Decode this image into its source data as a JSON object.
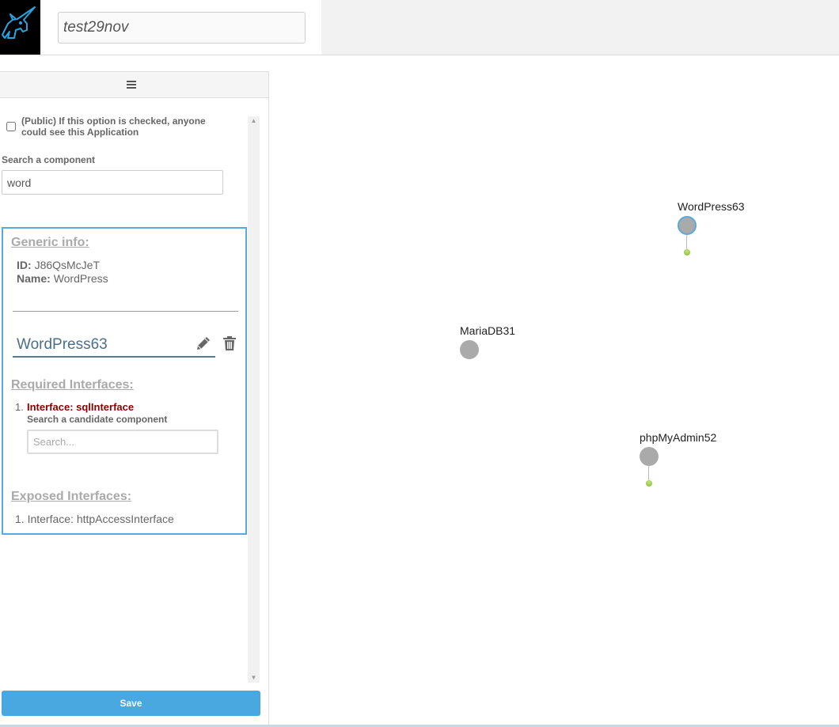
{
  "header": {
    "app_name": "test29nov",
    "logo_icon": "unicorn-logo-icon"
  },
  "sidebar": {
    "menu_icon": "hamburger-menu-icon",
    "public_option": {
      "label": "(Public) If this option is checked, anyone could see this Application",
      "checked": false
    },
    "search": {
      "label": "Search a component",
      "value": "word"
    },
    "details": {
      "generic_info_title": "Generic info:",
      "id_label": "ID:",
      "id_value": "J86QsMcJeT",
      "name_label": "Name:",
      "name_value": "WordPress",
      "instance_name": "WordPress63",
      "required_title": "Required Interfaces:",
      "required_interfaces": [
        {
          "num": "1.",
          "label": "Interface: sqlInterface"
        }
      ],
      "candidate_label": "Search a candidate component",
      "candidate_placeholder": "Search...",
      "exposed_title": "Exposed Interfaces:",
      "exposed_interfaces": [
        {
          "label": "1. Interface: httpAccessInterface"
        }
      ]
    },
    "save_label": "Save"
  },
  "graph": {
    "nodes": [
      {
        "label": "WordPress63",
        "selected": true
      },
      {
        "label": "MariaDB31",
        "selected": false
      },
      {
        "label": "phpMyAdmin52",
        "selected": false
      }
    ]
  },
  "colors": {
    "accent": "#4aa8e0",
    "node": "#aaaaaa",
    "required_interface": "#8b0000"
  }
}
